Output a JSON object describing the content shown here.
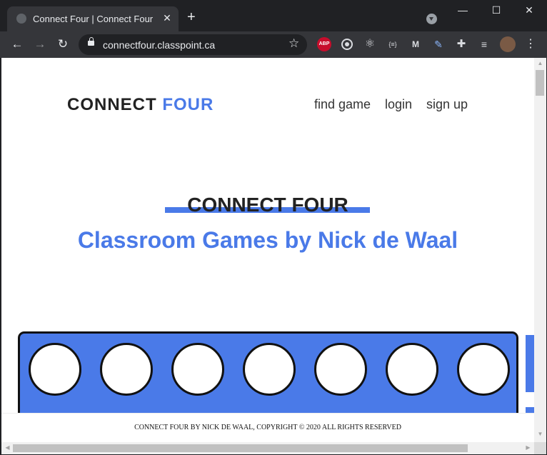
{
  "browser": {
    "tab_title": "Connect Four | Connect Four",
    "tab_close": "✕",
    "new_tab": "+",
    "url": "connectfour.classpoint.ca",
    "ext_abp": "ABP",
    "ext_braces": "{≡}",
    "ext_mm": "M"
  },
  "page": {
    "brand_part1": "CONNECT",
    "brand_part2": "FOUR",
    "nav": {
      "find_game": "find game",
      "login": "login",
      "sign_up": "sign up"
    },
    "hero_title": "CONNECT FOUR",
    "hero_subtitle": "Classroom Games by Nick de Waal",
    "footer": "CONNECT FOUR BY NICK DE WAAL, COPYRIGHT © 2020 ALL RIGHTS RESERVED"
  },
  "colors": {
    "accent": "#4a7ae8",
    "text_dark": "#222222",
    "browser_bg": "#202124"
  }
}
